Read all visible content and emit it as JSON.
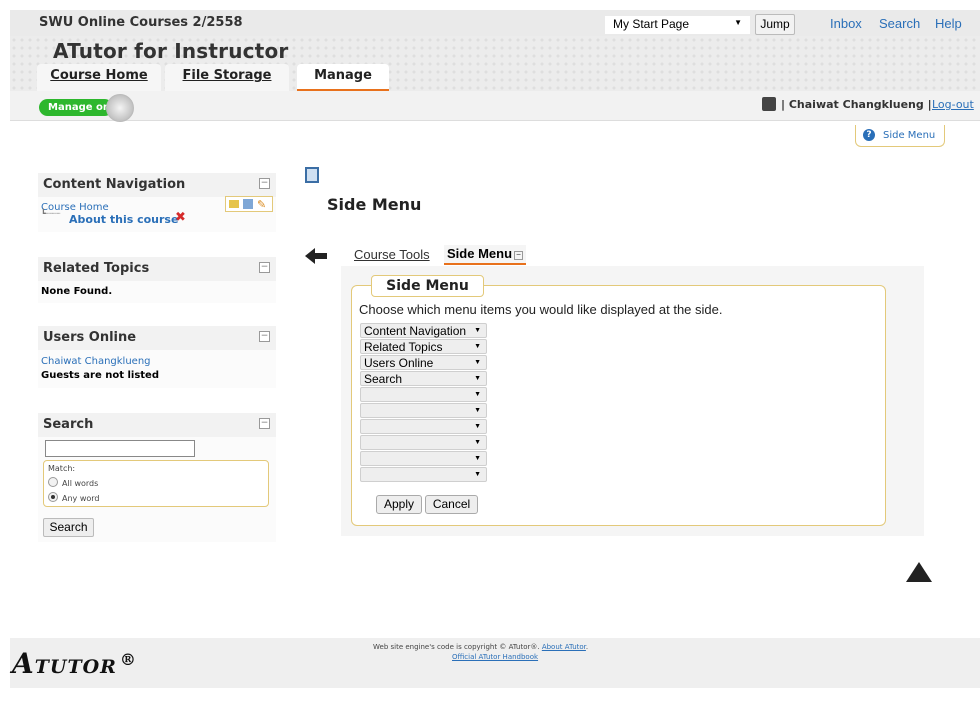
{
  "topbar": {
    "site_title": "SWU Online Courses 2/2558",
    "jump_selected": "My Start Page",
    "jump_label": "Jump",
    "links": [
      "Inbox",
      "Search",
      "Help"
    ]
  },
  "header": {
    "course_title": "ATutor for Instructor",
    "tabs": [
      "Course Home",
      "File Storage",
      "Manage"
    ]
  },
  "managebar": {
    "toggle_label": "Manage on",
    "user_name": "Chaiwat Changklueng",
    "logout": "Log-out"
  },
  "side_menu_tab": {
    "label": "Side Menu",
    "icon": "?"
  },
  "sidebar": {
    "content_navigation": {
      "title": "Content Navigation",
      "course_home": "Course Home",
      "item": "About this course"
    },
    "related_topics": {
      "title": "Related Topics",
      "body": "None Found."
    },
    "users_online": {
      "title": "Users Online",
      "user": "Chaiwat Changklueng",
      "note": "Guests are not listed"
    },
    "search": {
      "title": "Search",
      "match_label": "Match:",
      "options": [
        "All words",
        "Any word"
      ],
      "button": "Search"
    },
    "minimize": "−"
  },
  "main": {
    "title": "Side Menu",
    "subtabs": [
      "Course Tools",
      "Side Menu"
    ],
    "legend": "Side Menu",
    "instructions": "Choose which menu items you would like displayed at the side.",
    "selects": [
      "Content Navigation",
      "Related Topics",
      "Users Online",
      "Search",
      "",
      "",
      "",
      "",
      "",
      ""
    ],
    "apply": "Apply",
    "cancel": "Cancel"
  },
  "footer": {
    "copyright": "Web site engine's code is copyright © ATutor®.",
    "about": "About ATutor",
    "handbook": "Official ATutor Handbook",
    "logo_a": "A",
    "logo_rest": "TUTOR",
    "logo_mark": "®"
  },
  "colors": {
    "accent": "#e8711c",
    "link": "#2a6fb8",
    "toggle": "#2db72d",
    "delete": "#d62b2b"
  }
}
